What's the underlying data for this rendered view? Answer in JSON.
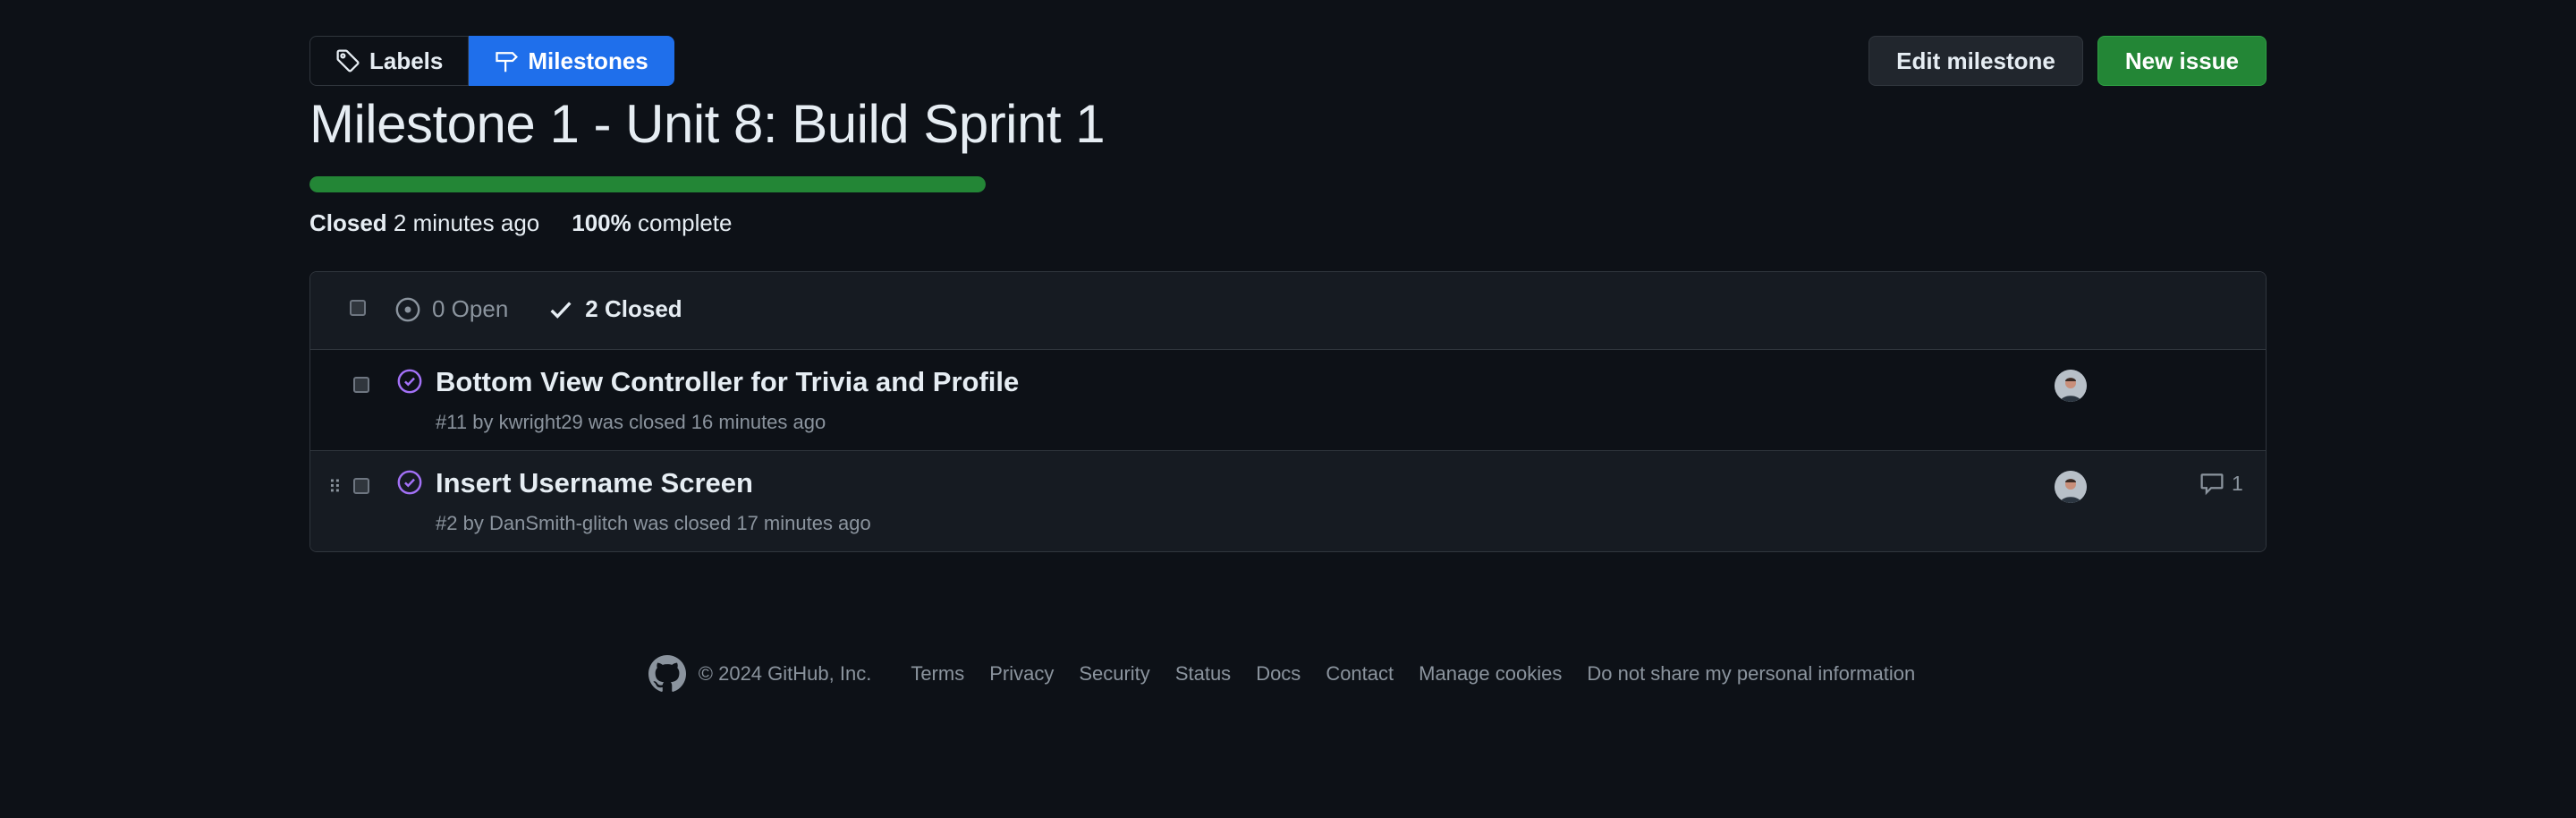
{
  "nav": {
    "labels_tab": "Labels",
    "milestones_tab": "Milestones",
    "edit_button": "Edit milestone",
    "new_issue_button": "New issue"
  },
  "milestone": {
    "title": "Milestone 1 - Unit 8: Build Sprint 1",
    "progress_percent": 100,
    "closed_label": "Closed",
    "closed_time": "2 minutes ago",
    "complete_percent": "100%",
    "complete_label": "complete"
  },
  "filters": {
    "open_label": "0 Open",
    "closed_label": "2 Closed"
  },
  "issues": [
    {
      "title": "Bottom View Controller for Trivia and Profile",
      "number": "#11",
      "by": "by",
      "author": "kwright29",
      "closed_text": "was closed 16 minutes ago",
      "comments": ""
    },
    {
      "title": "Insert Username Screen",
      "number": "#2",
      "by": "by",
      "author": "DanSmith-glitch",
      "closed_text": "was closed 17 minutes ago",
      "comments": "1"
    }
  ],
  "footer": {
    "copyright": "© 2024 GitHub, Inc.",
    "links": [
      "Terms",
      "Privacy",
      "Security",
      "Status",
      "Docs",
      "Contact",
      "Manage cookies",
      "Do not share my personal information"
    ]
  },
  "colors": {
    "background": "#0d1117",
    "accent_blue": "#1f6feb",
    "success_green": "#238636",
    "closed_purple": "#a371f7"
  }
}
